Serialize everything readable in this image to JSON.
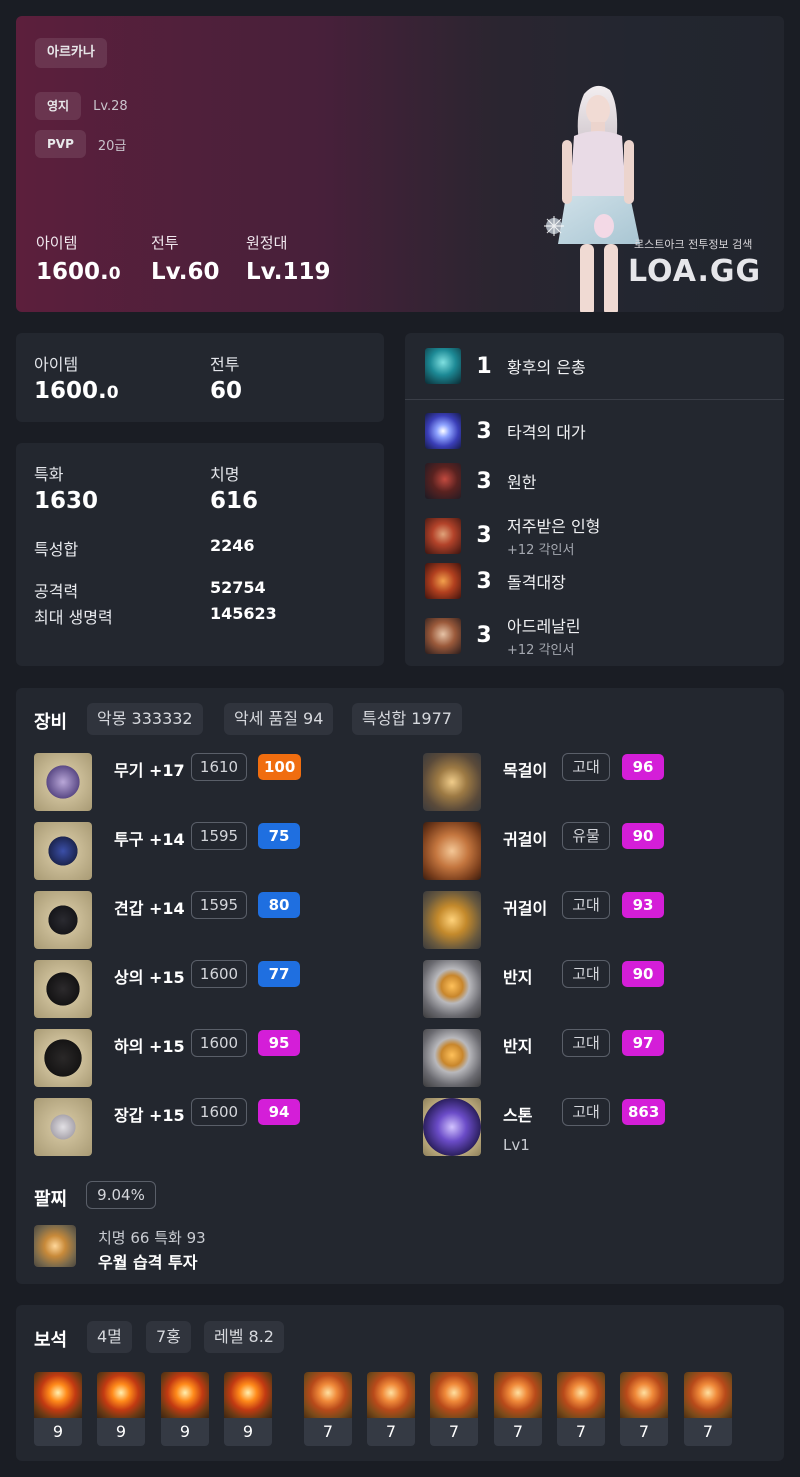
{
  "hero": {
    "class_name": "아르카나",
    "estate_label": "영지",
    "estate_value": "Lv.28",
    "pvp_label": "PVP",
    "pvp_value": "20급",
    "item_label": "아이템",
    "item_main": "1600.",
    "item_dec": "0",
    "combat_label": "전투",
    "combat_value": "Lv.60",
    "expedition_label": "원정대",
    "expedition_value": "Lv.119",
    "brand_sub": "로스트아크 전투정보 검색",
    "brand": "LOA.GG"
  },
  "summary": {
    "item_label": "아이템",
    "item_main": "1600.",
    "item_dec": "0",
    "combat_label": "전투",
    "combat_value": "60"
  },
  "stats": {
    "spec_label": "특화",
    "spec_value": "1630",
    "crit_label": "치명",
    "crit_value": "616",
    "total_label": "특성합",
    "total_value": "2246",
    "atk_label": "공격력",
    "atk_value": "52754",
    "hp_label": "최대 생명력",
    "hp_value": "145623"
  },
  "engravings": [
    {
      "level": "1",
      "name": "황후의 은총",
      "sub": "",
      "icon": "empress-grace-icon"
    },
    {
      "level": "3",
      "name": "타격의 대가",
      "sub": "",
      "icon": "master-of-strike-icon"
    },
    {
      "level": "3",
      "name": "원한",
      "sub": "",
      "icon": "grudge-icon"
    },
    {
      "level": "3",
      "name": "저주받은 인형",
      "sub": "+12 각인서",
      "icon": "cursed-doll-icon"
    },
    {
      "level": "3",
      "name": "돌격대장",
      "sub": "",
      "icon": "raid-captain-icon"
    },
    {
      "level": "3",
      "name": "아드레날린",
      "sub": "+12 각인서",
      "icon": "adrenaline-icon"
    }
  ],
  "equipment": {
    "title": "장비",
    "tags": [
      "악몽 333332",
      "악세 품질 94",
      "특성합 1977"
    ],
    "gear": [
      {
        "name": "무기 +17",
        "level": "1610",
        "quality": "100",
        "color": "#f06d0f",
        "icon": "weapon-icon"
      },
      {
        "name": "투구 +14",
        "level": "1595",
        "quality": "75",
        "color": "#1f6fe0",
        "icon": "helmet-icon"
      },
      {
        "name": "견갑 +14",
        "level": "1595",
        "quality": "80",
        "color": "#1f6fe0",
        "icon": "shoulder-icon"
      },
      {
        "name": "상의 +15",
        "level": "1600",
        "quality": "77",
        "color": "#1f6fe0",
        "icon": "chest-icon"
      },
      {
        "name": "하의 +15",
        "level": "1600",
        "quality": "95",
        "color": "#d41ed8",
        "icon": "pants-icon"
      },
      {
        "name": "장갑 +15",
        "level": "1600",
        "quality": "94",
        "color": "#d41ed8",
        "icon": "gloves-icon"
      }
    ],
    "accessories": [
      {
        "name": "목걸이",
        "grade": "고대",
        "quality": "96",
        "color": "#d41ed8",
        "icon": "necklace-icon"
      },
      {
        "name": "귀걸이",
        "grade": "유물",
        "quality": "90",
        "color": "#d41ed8",
        "icon": "earring-icon"
      },
      {
        "name": "귀걸이",
        "grade": "고대",
        "quality": "93",
        "color": "#d41ed8",
        "icon": "earring-icon"
      },
      {
        "name": "반지",
        "grade": "고대",
        "quality": "90",
        "color": "#d41ed8",
        "icon": "ring-icon"
      },
      {
        "name": "반지",
        "grade": "고대",
        "quality": "97",
        "color": "#d41ed8",
        "icon": "ring-icon"
      },
      {
        "name": "스톤",
        "grade": "고대",
        "quality": "863",
        "color": "#d41ed8",
        "icon": "ability-stone-icon",
        "sub": "Lv1"
      }
    ],
    "bracelet_title": "팔찌",
    "bracelet_pct": "9.04%",
    "bracelet_line1": "치명 66  특화 93",
    "bracelet_line2": "우월  습격  투자"
  },
  "gems": {
    "title": "보석",
    "tags": [
      "4멸",
      "7홍",
      "레벨 8.2"
    ],
    "levels": [
      "9",
      "9",
      "9",
      "9",
      "7",
      "7",
      "7",
      "7",
      "7",
      "7",
      "7"
    ]
  }
}
